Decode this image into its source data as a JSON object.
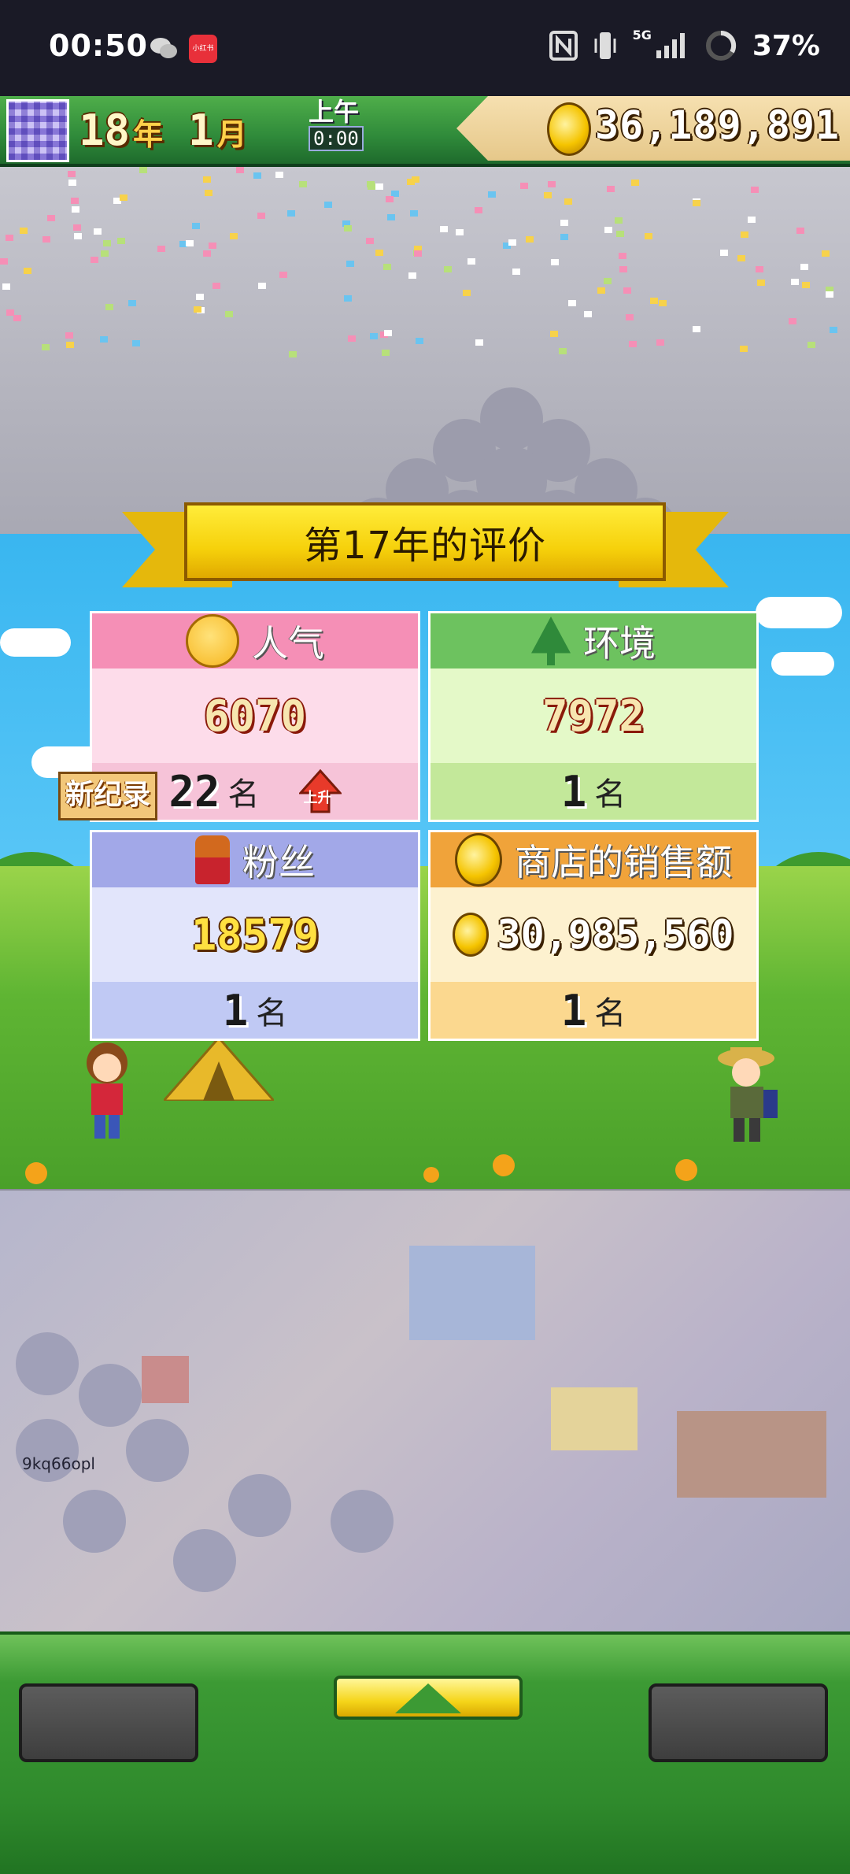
{
  "status_bar": {
    "time": "00:50",
    "app_badge": "小红书",
    "network": "5G",
    "battery": "37%"
  },
  "hud": {
    "year": "18",
    "year_unit": "年",
    "month": "1",
    "month_unit": "月",
    "period": "上午",
    "clock": "0:00",
    "money": "36,189,891"
  },
  "evaluation": {
    "title": "第17年的评价",
    "cards": {
      "popularity": {
        "label": "人气",
        "value": "6070",
        "rank": "22",
        "rank_unit": "名",
        "trend": "上升"
      },
      "environment": {
        "label": "环境",
        "value": "7972",
        "rank": "1",
        "rank_unit": "名"
      },
      "fans": {
        "label": "粉丝",
        "value": "18579",
        "rank": "1",
        "rank_unit": "名"
      },
      "shop_sales": {
        "label": "商店的销售额",
        "value": "30,985,560",
        "rank": "1",
        "rank_unit": "名"
      }
    },
    "new_record_label": "新纪录"
  },
  "overlay_text": "9kq66opl",
  "colors": {
    "popularity_head": "#f58fb6",
    "popularity_body": "#fddcea",
    "popularity_rank": "#f6c3d8",
    "environment_head": "#6dc25f",
    "environment_body": "#e4f9c8",
    "environment_rank": "#c3e89a",
    "fans_head": "#a2a8e8",
    "fans_body": "#e2e5fb",
    "fans_rank": "#c0c9f4",
    "sales_head": "#f0a33a",
    "sales_body": "#fdf1cf",
    "sales_rank": "#fbd88f"
  }
}
